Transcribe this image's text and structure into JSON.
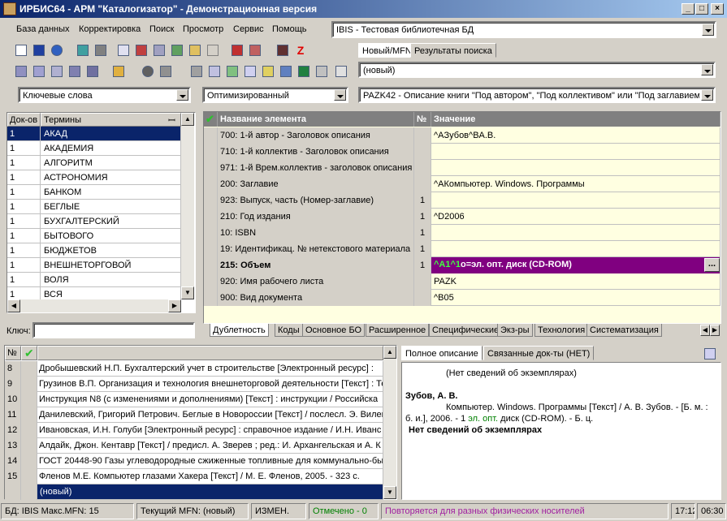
{
  "window": {
    "title": "ИРБИС64 - АРМ \"Каталогизатор\" - Демонстрационная версия",
    "min": "_",
    "max": "□",
    "close": "×"
  },
  "menu": [
    "База данных",
    "Корректировка",
    "Поиск",
    "Просмотр",
    "Сервис",
    "Помощь"
  ],
  "db_combo": "IBIS - Тестовая библиотечная БД",
  "mfn_tabs": [
    "Новый/MFN",
    "Результаты поиска"
  ],
  "mfn_combo": "(новый)",
  "search_combo": "Ключевые слова",
  "mode_combo": "Оптимизированный",
  "worksheet_combo": "PAZK42 - Описание книги \"Под автором\", \"Под коллективом\" или \"Под заглавием\"",
  "terms": {
    "col_docs": "Док-ов",
    "col_terms": "Термины",
    "pin": "ꟷ",
    "rows": [
      [
        "1",
        "АКАД"
      ],
      [
        "1",
        "АКАДЕМИЯ"
      ],
      [
        "1",
        "АЛГОРИТМ"
      ],
      [
        "1",
        "АСТРОНОМИЯ"
      ],
      [
        "1",
        "БАНКОМ"
      ],
      [
        "1",
        "БЕГЛЫЕ"
      ],
      [
        "1",
        "БУХГАЛТЕРСКИЙ"
      ],
      [
        "1",
        "БЫТОВОГО"
      ],
      [
        "1",
        "БЮДЖЕТОВ"
      ],
      [
        "1",
        "ВНЕШНЕТОРГОВОЙ"
      ],
      [
        "1",
        "ВОЛЯ"
      ],
      [
        "1",
        "ВСЯ"
      ]
    ],
    "key_label": "Ключ:",
    "key_value": ""
  },
  "editor": {
    "check": "✔",
    "col_name": "Название элемента",
    "col_no": "№",
    "col_value": "Значение",
    "rows": [
      {
        "name": "700: 1-й автор - Заголовок описания",
        "no": "",
        "value": "^AЗубов^BA.B."
      },
      {
        "name": "710: 1-й коллектив - Заголовок описания",
        "no": "",
        "value": ""
      },
      {
        "name": "971: 1-й Врем.коллектив - заголовок описания",
        "no": "",
        "value": ""
      },
      {
        "name": "200: Заглавие",
        "no": "",
        "value": "^AКомпьютер. Windows. Программы"
      },
      {
        "name": "923: Выпуск, часть (Номер-заглавие)",
        "no": "1",
        "value": ""
      },
      {
        "name": "210: Год издания",
        "no": "1",
        "value": "^D2006"
      },
      {
        "name": "10: ISBN",
        "no": "1",
        "value": ""
      },
      {
        "name": "19: Идентификац. № нетекстового материала",
        "no": "1",
        "value": ""
      },
      {
        "name": "215: Объем",
        "no": "1",
        "value": "^A1^1o=эл. опт. диск (CD-ROM)"
      },
      {
        "name": "920: Имя рабочего листа",
        "no": "",
        "value": "PAZK"
      },
      {
        "name": "900: Вид документа",
        "no": "",
        "value": "^B05"
      }
    ],
    "value_prefix": "^A1^1",
    "value_rest": "o=эл. опт. диск (CD-ROM)",
    "ellipsis": "...",
    "tabs": [
      "Дублетность",
      "Коды",
      "Основное БО",
      "Расширенное",
      "Специфические",
      "Экз-ры",
      "Технология",
      "Систематизация"
    ]
  },
  "records": {
    "col_no": "№",
    "check": "✔",
    "rows": [
      [
        "8",
        "Дробышевский Н.П. Бухгалтерский учет в строительстве [Электронный ресурс] :"
      ],
      [
        "9",
        "Грузинов В.П. Организация и технология внешнеторговой деятельности [Текст] : Те"
      ],
      [
        "10",
        "Инструкция N8  (с изменениями и дополнениями) [Текст] : инструкции / Российска"
      ],
      [
        "11",
        "Данилевский, Григорий Петрович. Беглые в Новороссии [Текст] / послесл. Э. Вилен"
      ],
      [
        "12",
        "Ивановская, И.Н. Голуби [Электронный ресурс] : справочное издание / И.Н. Иванс"
      ],
      [
        "13",
        "Алдайк, Джон. Кентавр [Текст] / предисл. А. Зверев ; ред.: И. Архангельская и А. К"
      ],
      [
        "14",
        "ГОСТ 20448-90 Газы углеводородные сжиженные топливные для коммунально-быт"
      ],
      [
        "15",
        "Фленов М.Е. Компьютер глазами Хакера [Текст] / М. Е. Фленов, 2005. - 323 с."
      ]
    ],
    "new_row": "(новый)"
  },
  "preview": {
    "tabs": [
      "Полное описание",
      "Связанные док-ты (НЕТ)"
    ],
    "line1": "(Нет сведений об экземплярах)",
    "author": "Зубов, А. В.",
    "desc1": "Компьютер. Windows. Программы [Текст] / А. В. Зубов. - [Б. м. :",
    "desc2a": "б. и.], 2006. - 1 ",
    "desc2b": "эл. опт.",
    "desc2c": " диск (CD-ROM). - Б. ц.",
    "line_last": "Нет сведений об экземплярах"
  },
  "status": {
    "db": "БД: IBIS Макс.MFN: 15",
    "mfn": "Текущий MFN: (новый)",
    "changed": "ИЗМЕН.",
    "marked": "Отмечено - 0",
    "repeat": "Повторяется для разных физических носителей",
    "time": "17:12",
    "time2": "06:30"
  },
  "colors": {
    "selection": "#0a246a",
    "purple": "#800080",
    "editor_bg": "#ffffe1",
    "marked": "#008000",
    "repeat": "#a020a0"
  }
}
